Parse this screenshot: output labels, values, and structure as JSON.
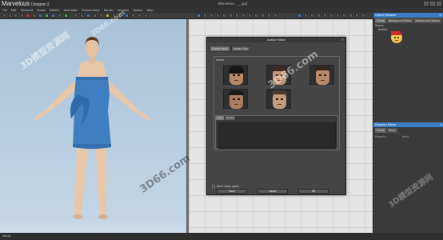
{
  "app": {
    "logo_main": "Marvelous",
    "logo_sub": "Designer 2",
    "window_title": "Marvelous ___.zprj"
  },
  "menu": [
    "File",
    "Edit",
    "Garment",
    "Shape",
    "Pattern",
    "Animation",
    "Environment",
    "Render",
    "Window",
    "Gallery",
    "Help"
  ],
  "right_panel": {
    "header": "Object Browser",
    "tabs": [
      "Scene",
      "Background Patch",
      "Background Avatar"
    ],
    "tree": [
      "Scene",
      "Avatar"
    ],
    "props_header": "Property Editor",
    "props_tabs": [
      "Scene",
      "Fabric"
    ],
    "props_cols": [
      "Property",
      "Value"
    ]
  },
  "dialog": {
    "title": "Avatar Editor",
    "tabs": [
      "Avatar Mesh",
      "Avatar Size"
    ],
    "group_label": "Avatar",
    "sub_tabs": [
      "Hair",
      "Shoes"
    ],
    "dont_show_label": "Don't show again",
    "buttons": [
      "Save",
      "Apply",
      "OK"
    ]
  },
  "status": {
    "text": "Ready"
  },
  "watermarks": [
    "3D模型资源网",
    "3D66.com",
    "3D66.com",
    "3D模型资源网",
    "3D66.com"
  ],
  "colors": {
    "accent_blue": "#3c7dc8",
    "dress_blue": "#3f7ec0",
    "viewport_bg": "#b0c7dc"
  },
  "icons": [
    "close-icon",
    "avatar-icon",
    "check-icon"
  ]
}
